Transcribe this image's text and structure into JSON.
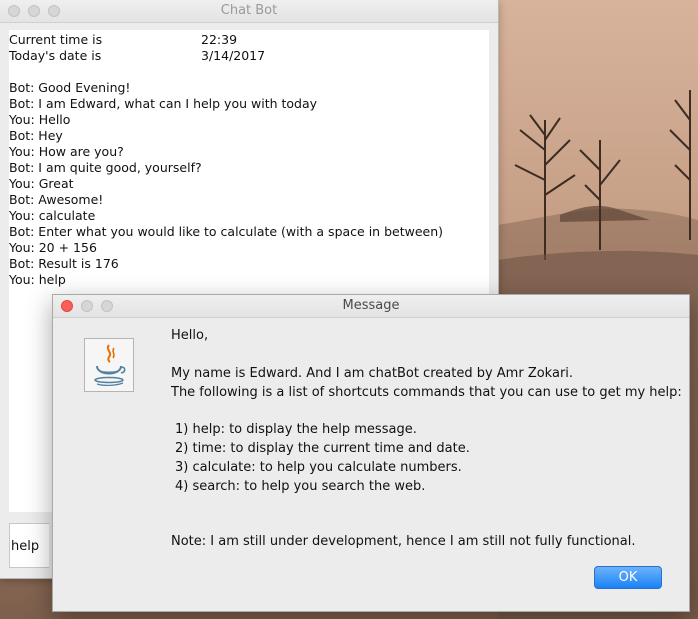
{
  "chat_window": {
    "title": "Chat Bot",
    "current_time_label": "Current time is",
    "current_time_value": "22:39",
    "date_label": "Today's date is",
    "date_value": "3/14/2017",
    "messages": [
      "Bot: Good Evening!",
      "Bot: I am Edward, what can I help you with today",
      "You: Hello",
      "Bot: Hey",
      "You: How are you?",
      "Bot: I am quite good, yourself?",
      "You: Great",
      "Bot: Awesome!",
      "You: calculate",
      "Bot: Enter what you would like to calculate (with a space in between)",
      "You: 20 + 156",
      "Bot: Result is 176",
      "You: help"
    ],
    "input_value": "help"
  },
  "dialog": {
    "title": "Message",
    "icon": "java-icon",
    "greeting": "Hello,",
    "intro": "My name is Edward. And I am chatBot created by Amr Zokari.",
    "list_intro": "The following is a list of shortcuts commands that you can use to get my help:",
    "commands": [
      "1) help: to display the help message.",
      "2) time: to display the current time and date.",
      "3) calculate: to help you calculate numbers.",
      "4) search: to help you search the web."
    ],
    "note": "Note: I am still under development, hence I am still not fully functional.",
    "ok_label": "OK"
  },
  "colors": {
    "ok_button": "#1a82f6",
    "close_button": "#fc5f57"
  }
}
